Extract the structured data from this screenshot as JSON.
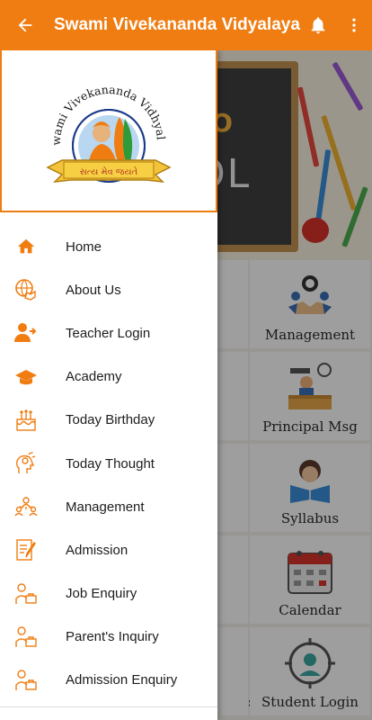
{
  "appbar": {
    "title": "Swami Vivekananda Vidyalaya",
    "back_icon": "arrow-left-icon",
    "notification_icon": "bell-icon",
    "more_icon": "more-vertical-icon",
    "color": "#f07d12"
  },
  "logo": {
    "arc_text": "Swami Vivekananda Vidhyalay",
    "ribbon_text": "સત્ય મેવ જયતે"
  },
  "banner": {
    "board_text_1": "TO",
    "board_text_2": "OL"
  },
  "menu": {
    "items": [
      {
        "label": "Home",
        "icon": "home-icon"
      },
      {
        "label": "About Us",
        "icon": "globe-hand-icon"
      },
      {
        "label": "Teacher Login",
        "icon": "user-login-icon"
      },
      {
        "label": "Academy",
        "icon": "graduation-cap-icon"
      },
      {
        "label": "Today Birthday",
        "icon": "birthday-cake-icon"
      },
      {
        "label": "Today Thought",
        "icon": "thought-head-icon"
      },
      {
        "label": "Management",
        "icon": "management-icon"
      },
      {
        "label": "Admission",
        "icon": "admission-form-icon"
      },
      {
        "label": "Job Enquiry",
        "icon": "job-enquiry-icon"
      },
      {
        "label": "Parent's Inquiry",
        "icon": "parent-inquiry-icon"
      },
      {
        "label": "Admission Enquiry",
        "icon": "admission-enquiry-icon"
      }
    ]
  },
  "tiles": {
    "management": "Management",
    "principal": "Principal Msg",
    "syllabus": "Syllabus",
    "calendar": "Calendar",
    "student_login": "Student Login",
    "left_partial_1": "ry",
    "left_partial_2": "s"
  },
  "colors": {
    "accent": "#f07d12",
    "drawer_bg": "#ffffff",
    "scrim": "rgba(0,0,0,0.38)"
  }
}
